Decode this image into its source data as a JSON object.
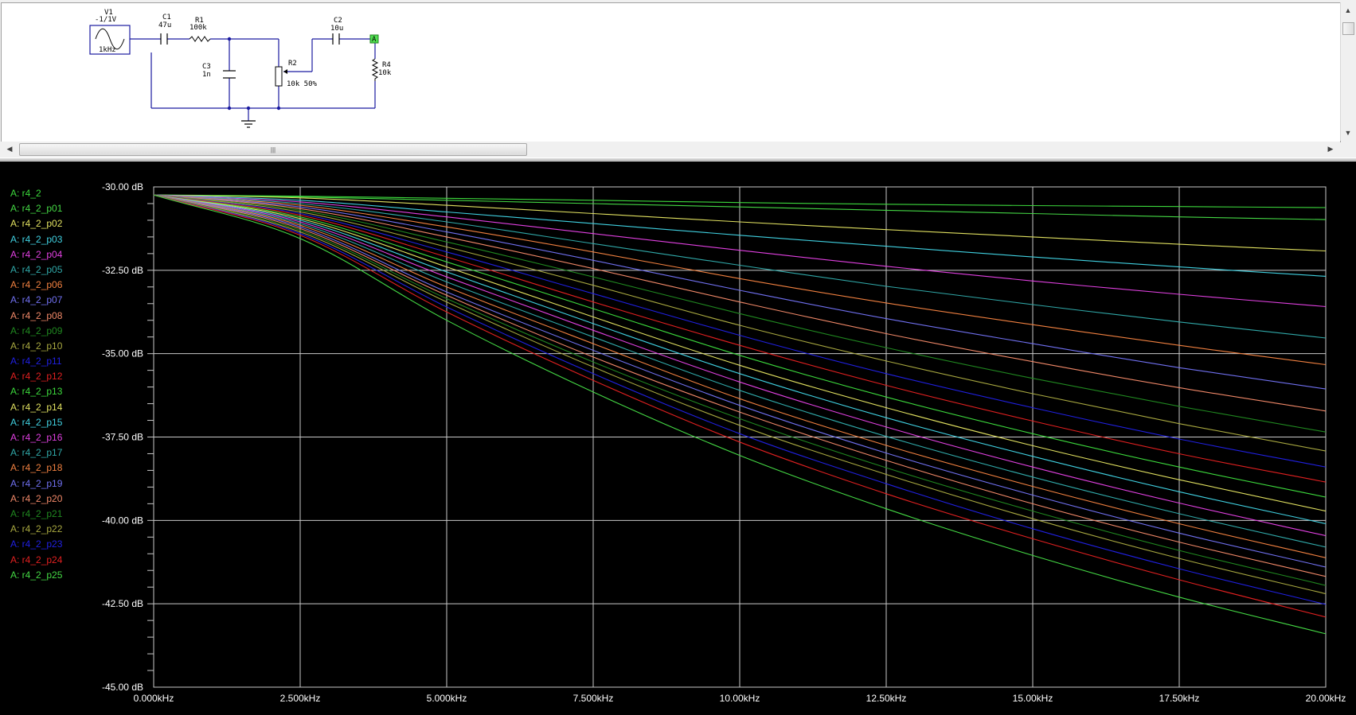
{
  "schematic": {
    "source": {
      "name": "V1",
      "amplitude": "-1/1V",
      "frequency": "1kHz"
    },
    "c1": {
      "name": "C1",
      "value": "47u"
    },
    "r1": {
      "name": "R1",
      "value": "100k"
    },
    "c3": {
      "name": "C3",
      "value": "1n"
    },
    "r2": {
      "name": "R2",
      "value": "10k 50%"
    },
    "c2": {
      "name": "C2",
      "value": "10u"
    },
    "r4": {
      "name": "R4",
      "value": "10k"
    },
    "probe": {
      "label": "A"
    }
  },
  "scrollbar": {
    "thumb_grip": "|||"
  },
  "colors": {
    "background": "#000000",
    "grid": "#c8c8c8",
    "axis_text": "#ffffff",
    "trace_palette": [
      "#3cd83c",
      "#44d844",
      "#e0e060",
      "#40d0e0",
      "#e040e0",
      "#30a8a8",
      "#f08040",
      "#7070f0",
      "#f08868",
      "#208820",
      "#a8a840",
      "#2020e0",
      "#e02020"
    ]
  },
  "chart_data": {
    "type": "line",
    "xlabel": "",
    "ylabel": "",
    "xlim": [
      0,
      20000
    ],
    "ylim": [
      -45,
      -30
    ],
    "x_ticks": [
      0,
      2500,
      5000,
      7500,
      10000,
      12500,
      15000,
      17500,
      20000
    ],
    "x_tick_labels": [
      "0.000kHz",
      "2.500kHz",
      "5.000kHz",
      "7.500kHz",
      "10.00kHz",
      "12.50kHz",
      "15.00kHz",
      "17.50kHz",
      "20.00kHz"
    ],
    "y_ticks": [
      -30,
      -32.5,
      -35,
      -37.5,
      -40,
      -42.5,
      -45
    ],
    "y_tick_labels": [
      "-30.00 dB",
      "-32.50 dB",
      "-35.00 dB",
      "-37.50 dB",
      "-40.00 dB",
      "-42.50 dB",
      "-45.00 dB"
    ],
    "grid": true,
    "legend_position": "left",
    "x": [
      0,
      2500,
      5000,
      7500,
      10000,
      12500,
      15000,
      17500,
      20000
    ],
    "series": [
      {
        "name": "A: r4_2",
        "color": "#3cd83c",
        "values": [
          -30.24,
          -30.28,
          -30.34,
          -30.4,
          -30.47,
          -30.52,
          -30.56,
          -30.59,
          -30.62
        ]
      },
      {
        "name": "A: r4_2_p01",
        "color": "#44d844",
        "values": [
          -30.24,
          -30.3,
          -30.4,
          -30.5,
          -30.6,
          -30.7,
          -30.8,
          -30.9,
          -30.98
        ]
      },
      {
        "name": "A: r4_2_p02",
        "color": "#e0e060",
        "values": [
          -30.24,
          -30.33,
          -30.55,
          -30.8,
          -31.05,
          -31.28,
          -31.5,
          -31.72,
          -31.92
        ]
      },
      {
        "name": "A: r4_2_p03",
        "color": "#40d0e0",
        "values": [
          -30.24,
          -30.4,
          -30.75,
          -31.1,
          -31.45,
          -31.78,
          -32.1,
          -32.4,
          -32.68
        ]
      },
      {
        "name": "A: r4_2_p04",
        "color": "#e040e0",
        "values": [
          -30.24,
          -30.45,
          -30.9,
          -31.4,
          -31.9,
          -32.38,
          -32.82,
          -33.22,
          -33.59
        ]
      },
      {
        "name": "A: r4_2_p05",
        "color": "#30a8a8",
        "values": [
          -30.24,
          -30.5,
          -31.05,
          -31.7,
          -32.35,
          -32.98,
          -33.53,
          -34.05,
          -34.53
        ]
      },
      {
        "name": "A: r4_2_p06",
        "color": "#f08040",
        "values": [
          -30.24,
          -30.55,
          -31.2,
          -31.95,
          -32.75,
          -33.48,
          -34.13,
          -34.75,
          -35.33
        ]
      },
      {
        "name": "A: r4_2_p07",
        "color": "#7070f0",
        "values": [
          -30.24,
          -30.6,
          -31.35,
          -32.2,
          -33.1,
          -33.95,
          -34.7,
          -35.42,
          -36.06
        ]
      },
      {
        "name": "A: r4_2_p08",
        "color": "#f08868",
        "values": [
          -30.24,
          -30.65,
          -31.5,
          -32.45,
          -33.45,
          -34.4,
          -35.24,
          -36.02,
          -36.72
        ]
      },
      {
        "name": "A: r4_2_p09",
        "color": "#208820",
        "values": [
          -30.24,
          -30.7,
          -31.65,
          -32.7,
          -33.8,
          -34.82,
          -35.74,
          -36.58,
          -37.35
        ]
      },
      {
        "name": "A: r4_2_p10",
        "color": "#a8a840",
        "values": [
          -30.24,
          -30.75,
          -31.8,
          -32.95,
          -34.15,
          -35.22,
          -36.2,
          -37.1,
          -37.92
        ]
      },
      {
        "name": "A: r4_2_p11",
        "color": "#2020e0",
        "values": [
          -30.24,
          -30.8,
          -31.95,
          -33.2,
          -34.45,
          -35.6,
          -36.62,
          -37.56,
          -38.4
        ]
      },
      {
        "name": "A: r4_2_p12",
        "color": "#e02020",
        "values": [
          -30.24,
          -30.85,
          -32.1,
          -33.45,
          -34.75,
          -35.95,
          -37.02,
          -38.0,
          -38.85
        ]
      },
      {
        "name": "A: r4_2_p13",
        "color": "#3cd83c",
        "values": [
          -30.24,
          -30.9,
          -32.25,
          -33.65,
          -35.05,
          -36.3,
          -37.4,
          -38.4,
          -39.3
        ]
      },
      {
        "name": "A: r4_2_p14",
        "color": "#e0e060",
        "values": [
          -30.24,
          -30.95,
          -32.4,
          -33.9,
          -35.35,
          -36.62,
          -37.76,
          -38.78,
          -39.72
        ]
      },
      {
        "name": "A: r4_2_p15",
        "color": "#40d0e0",
        "values": [
          -30.24,
          -31.0,
          -32.55,
          -34.1,
          -35.6,
          -36.92,
          -38.08,
          -39.14,
          -40.1
        ]
      },
      {
        "name": "A: r4_2_p16",
        "color": "#e040e0",
        "values": [
          -30.24,
          -31.05,
          -32.7,
          -34.3,
          -35.85,
          -37.2,
          -38.4,
          -39.48,
          -40.46
        ]
      },
      {
        "name": "A: r4_2_p17",
        "color": "#30a8a8",
        "values": [
          -30.24,
          -31.1,
          -32.85,
          -34.5,
          -36.1,
          -37.48,
          -38.7,
          -39.8,
          -40.8
        ]
      },
      {
        "name": "A: r4_2_p18",
        "color": "#f08040",
        "values": [
          -30.24,
          -31.15,
          -33.0,
          -34.7,
          -36.35,
          -37.75,
          -38.98,
          -40.1,
          -41.12
        ]
      },
      {
        "name": "A: r4_2_p19",
        "color": "#7070f0",
        "values": [
          -30.24,
          -31.2,
          -33.15,
          -34.9,
          -36.55,
          -37.98,
          -39.24,
          -40.38,
          -41.4
        ]
      },
      {
        "name": "A: r4_2_p20",
        "color": "#f08868",
        "values": [
          -30.24,
          -31.25,
          -33.25,
          -35.1,
          -36.75,
          -38.2,
          -39.5,
          -40.65,
          -41.68
        ]
      },
      {
        "name": "A: r4_2_p21",
        "color": "#208820",
        "values": [
          -30.24,
          -31.3,
          -33.35,
          -35.25,
          -36.95,
          -38.42,
          -39.72,
          -40.9,
          -41.95
        ]
      },
      {
        "name": "A: r4_2_p22",
        "color": "#a8a840",
        "values": [
          -30.24,
          -31.35,
          -33.45,
          -35.4,
          -37.15,
          -38.62,
          -39.95,
          -41.14,
          -42.2
        ]
      },
      {
        "name": "A: r4_2_p23",
        "color": "#2020e0",
        "values": [
          -30.24,
          -31.4,
          -33.6,
          -35.6,
          -37.4,
          -38.9,
          -40.25,
          -41.45,
          -42.52
        ]
      },
      {
        "name": "A: r4_2_p24",
        "color": "#e02020",
        "values": [
          -30.24,
          -31.45,
          -33.75,
          -35.8,
          -37.65,
          -39.2,
          -40.55,
          -41.78,
          -42.9
        ]
      },
      {
        "name": "A: r4_2_p25",
        "color": "#44d844",
        "values": [
          -30.24,
          -31.55,
          -34.0,
          -36.15,
          -38.05,
          -39.65,
          -41.05,
          -42.3,
          -43.4
        ]
      }
    ]
  }
}
